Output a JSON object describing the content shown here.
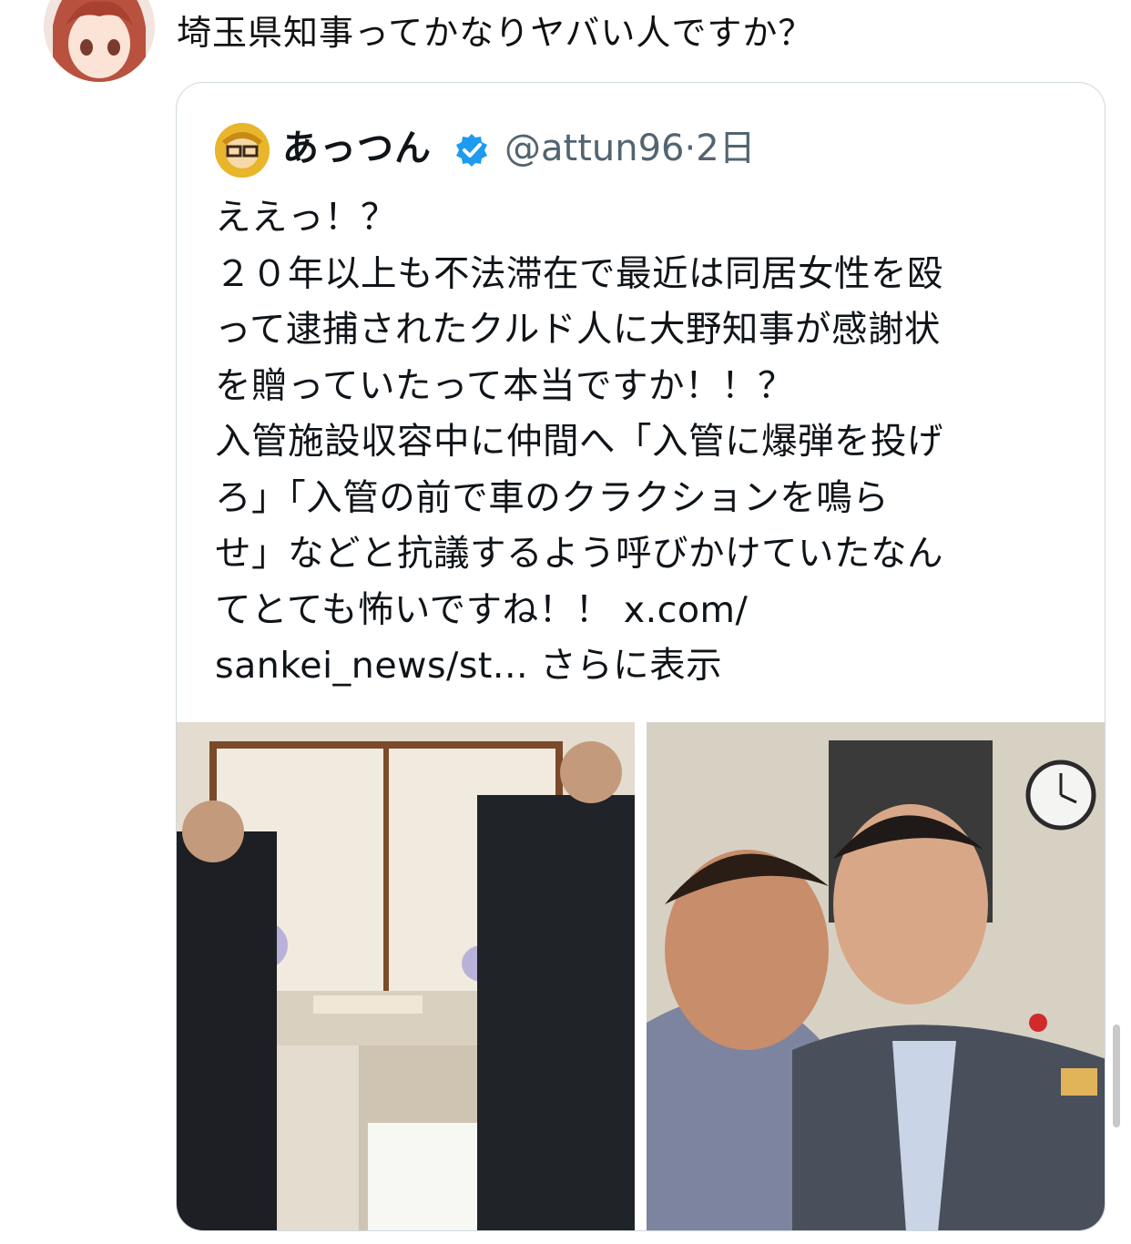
{
  "post": {
    "text": "埼玉県知事ってかなりヤバい人ですか？"
  },
  "quoted": {
    "name": "あっつん",
    "handle": "@attun96",
    "separator": "·",
    "time": "2日",
    "lines": [
      "ええっ！？",
      "２０年以上も不法滞在で最近は同居女性を殴",
      "って逮捕されたクルド人に大野知事が感謝状",
      "を贈っていたって本当ですか！！？",
      "入管施設収容中に仲間へ「入管に爆弾を投げ",
      "ろ」「入管の前で車のクラクションを鳴ら",
      "せ」などと抗議するよう呼びかけていたなん"
    ],
    "last_line_text": "てとても怖いですね！！ ",
    "link_part1": "x.com/",
    "link_part2": "sankei_news/st...",
    "show_more": "さらに表示"
  },
  "colors": {
    "border": "#cfd9de",
    "verified": "#1d9bf0",
    "secondary_text": "#536471"
  },
  "icons": {
    "verified": "verified-badge-icon"
  }
}
